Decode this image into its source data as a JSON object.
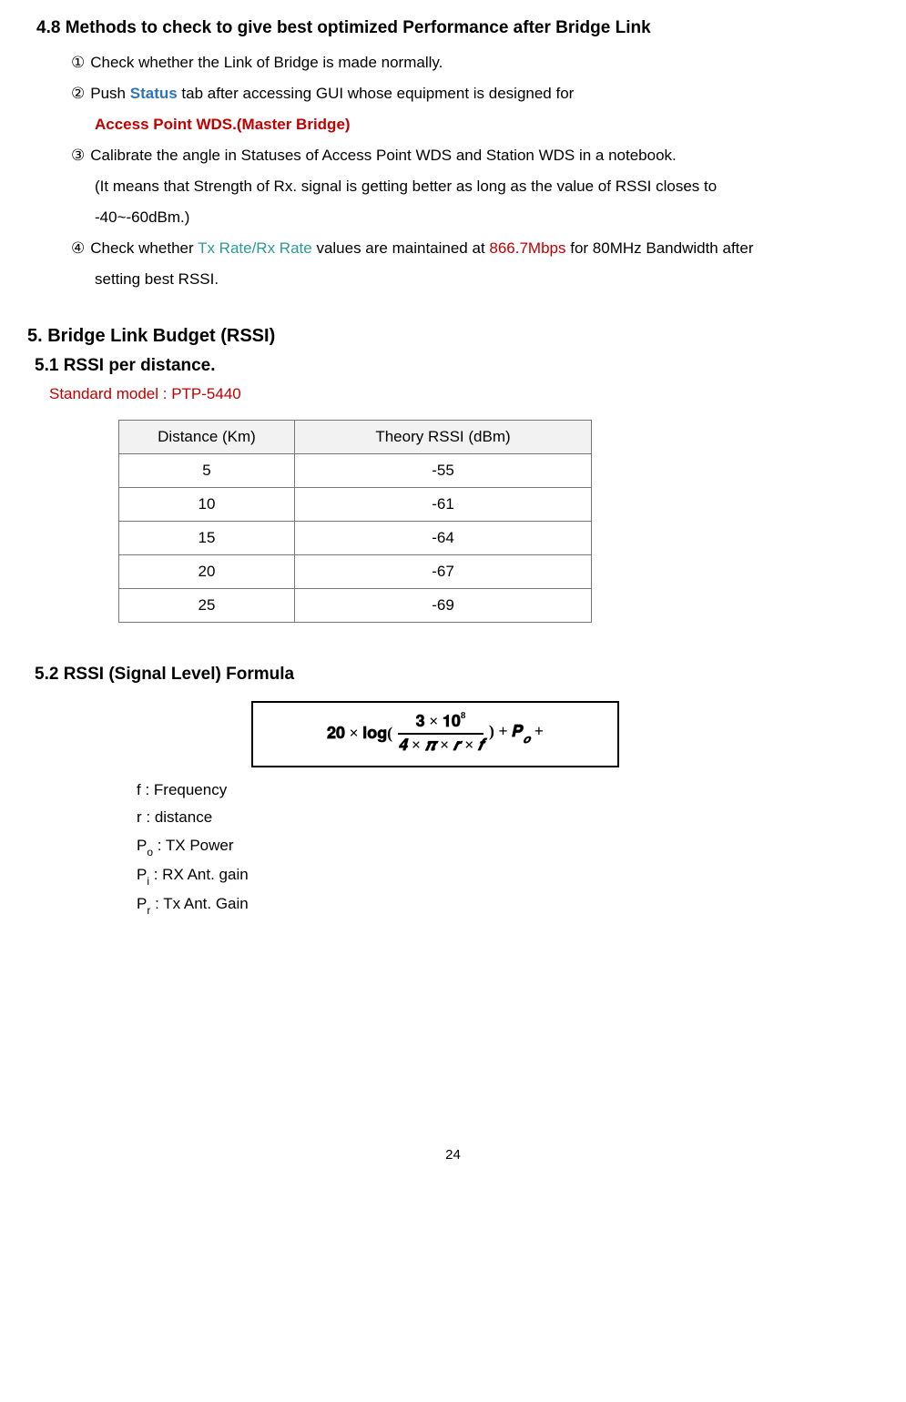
{
  "section48": {
    "title": "4.8 Methods to check to give best optimized Performance after Bridge Link",
    "item1": "Check whether the Link of Bridge is made normally.",
    "item2_a": "Push ",
    "item2_status": "Status",
    "item2_b": " tab after accessing GUI whose equipment is designed for",
    "item2_red": "Access Point WDS.(Master Bridge)",
    "item3_a": "Calibrate the angle in Statuses of Access Point WDS and Station WDS in a notebook.",
    "item3_b": "(It means that Strength of Rx. signal is getting better as long as the value of RSSI closes to",
    "item3_c": "-40~-60dBm.)",
    "item4_a": "Check whether ",
    "item4_txrx": "Tx Rate/Rx Rate",
    "item4_b": " values are maintained at ",
    "item4_mbps": "866.7Mbps",
    "item4_c": " for 80MHz Bandwidth after",
    "item4_d": "setting best RSSI.",
    "m1": "①",
    "m2": "②",
    "m3": "③",
    "m4": "④"
  },
  "section5": {
    "title": "5. Bridge Link Budget (RSSI)"
  },
  "section51": {
    "title": "5.1 RSSI per distance.",
    "model": "Standard model : PTP-5440",
    "col1": "Distance (Km)",
    "col2": "Theory RSSI (dBm)"
  },
  "chart_data": {
    "type": "table",
    "columns": [
      "Distance (Km)",
      "Theory RSSI (dBm)"
    ],
    "rows": [
      {
        "distance": "5",
        "rssi": "-55"
      },
      {
        "distance": "10",
        "rssi": "-61"
      },
      {
        "distance": "15",
        "rssi": "-64"
      },
      {
        "distance": "20",
        "rssi": "-67"
      },
      {
        "distance": "25",
        "rssi": "-69"
      }
    ]
  },
  "section52": {
    "title": "5.2 RSSI (Signal Level) Formula",
    "formula": {
      "lead": "𝟐𝟎 × 𝐥𝐨𝐠(",
      "num_a": "𝟑 × 𝟏𝟎",
      "num_sup": "8",
      "den": "𝟒 × 𝝅 × 𝒓 × 𝒇",
      "tail": ") + 𝑷",
      "tail_sub": "𝒐",
      "tail_end": " +"
    },
    "defs": {
      "f": "f : Frequency",
      "r": "r : distance",
      "po_a": "P",
      "po_sub": "o",
      "po_b": " : TX Power",
      "pi_a": "P",
      "pi_sub": "i",
      "pi_b": " : RX Ant. gain",
      "pr_a": "P",
      "pr_sub": "r",
      "pr_b": " : Tx Ant. Gain"
    }
  },
  "page_number": "24"
}
